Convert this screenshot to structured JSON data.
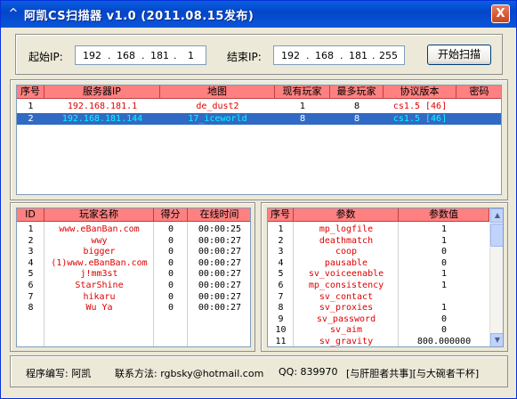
{
  "window": {
    "title": "阿凯CS扫描器  v1.0  (2011.08.15发布)",
    "close_label": "X",
    "app_icon": "app-icon"
  },
  "scan": {
    "start_label": "起始IP:",
    "start_ip": [
      "192",
      "168",
      "181",
      "1"
    ],
    "end_label": "结束IP:",
    "end_ip": [
      "192",
      "168",
      "181",
      "255"
    ],
    "button_label": "开始扫描"
  },
  "servers": {
    "headers": [
      "序号",
      "服务器IP",
      "地图",
      "现有玩家",
      "最多玩家",
      "协议版本",
      "密码"
    ],
    "rows": [
      {
        "no": "1",
        "ip": "192.168.181.1",
        "map": "de_dust2",
        "players": "1",
        "max": "8",
        "proto": "cs1.5 [46]",
        "pwd": "",
        "selected": false
      },
      {
        "no": "2",
        "ip": "192.168.181.144",
        "map": "17_iceworld",
        "players": "8",
        "max": "8",
        "proto": "cs1.5 [46]",
        "pwd": "",
        "selected": true
      }
    ]
  },
  "players": {
    "headers": [
      "ID",
      "玩家名称",
      "得分",
      "在线时间"
    ],
    "rows": [
      {
        "id": "1",
        "name": "www.eBanBan.com",
        "score": "0",
        "time": "00:00:25"
      },
      {
        "id": "2",
        "name": "wwy",
        "score": "0",
        "time": "00:00:27"
      },
      {
        "id": "3",
        "name": "bigger",
        "score": "0",
        "time": "00:00:27"
      },
      {
        "id": "4",
        "name": "(1)www.eBanBan.com",
        "score": "0",
        "time": "00:00:27"
      },
      {
        "id": "5",
        "name": "j!mm3st",
        "score": "0",
        "time": "00:00:27"
      },
      {
        "id": "6",
        "name": "StarShine",
        "score": "0",
        "time": "00:00:27"
      },
      {
        "id": "7",
        "name": "hikaru",
        "score": "0",
        "time": "00:00:27"
      },
      {
        "id": "8",
        "name": "Wu Ya",
        "score": "0",
        "time": "00:00:27"
      }
    ]
  },
  "params": {
    "headers": [
      "序号",
      "参数",
      "参数值"
    ],
    "rows": [
      {
        "no": "1",
        "name": "mp_logfile",
        "value": "1"
      },
      {
        "no": "2",
        "name": "deathmatch",
        "value": "1"
      },
      {
        "no": "3",
        "name": "coop",
        "value": "0"
      },
      {
        "no": "4",
        "name": "pausable",
        "value": "0"
      },
      {
        "no": "5",
        "name": "sv_voiceenable",
        "value": "1"
      },
      {
        "no": "6",
        "name": "mp_consistency",
        "value": "1"
      },
      {
        "no": "7",
        "name": "sv_contact",
        "value": ""
      },
      {
        "no": "8",
        "name": "sv_proxies",
        "value": "1"
      },
      {
        "no": "9",
        "name": "sv_password",
        "value": "0"
      },
      {
        "no": "10",
        "name": "sv_aim",
        "value": "0"
      },
      {
        "no": "11",
        "name": "sv_gravity",
        "value": "800.000000"
      }
    ]
  },
  "footer": {
    "author": "程序编写: 阿凯",
    "contact": "联系方法: rgbsky@hotmail.com",
    "qq": "QQ: 839970",
    "slogan": "[与肝胆者共事][与大碗者干杯]"
  },
  "colors": {
    "header_bg": "#ff8080",
    "selected_bg": "#316ac5",
    "selected_text": "#00ffff",
    "text_red": "#e00000"
  }
}
